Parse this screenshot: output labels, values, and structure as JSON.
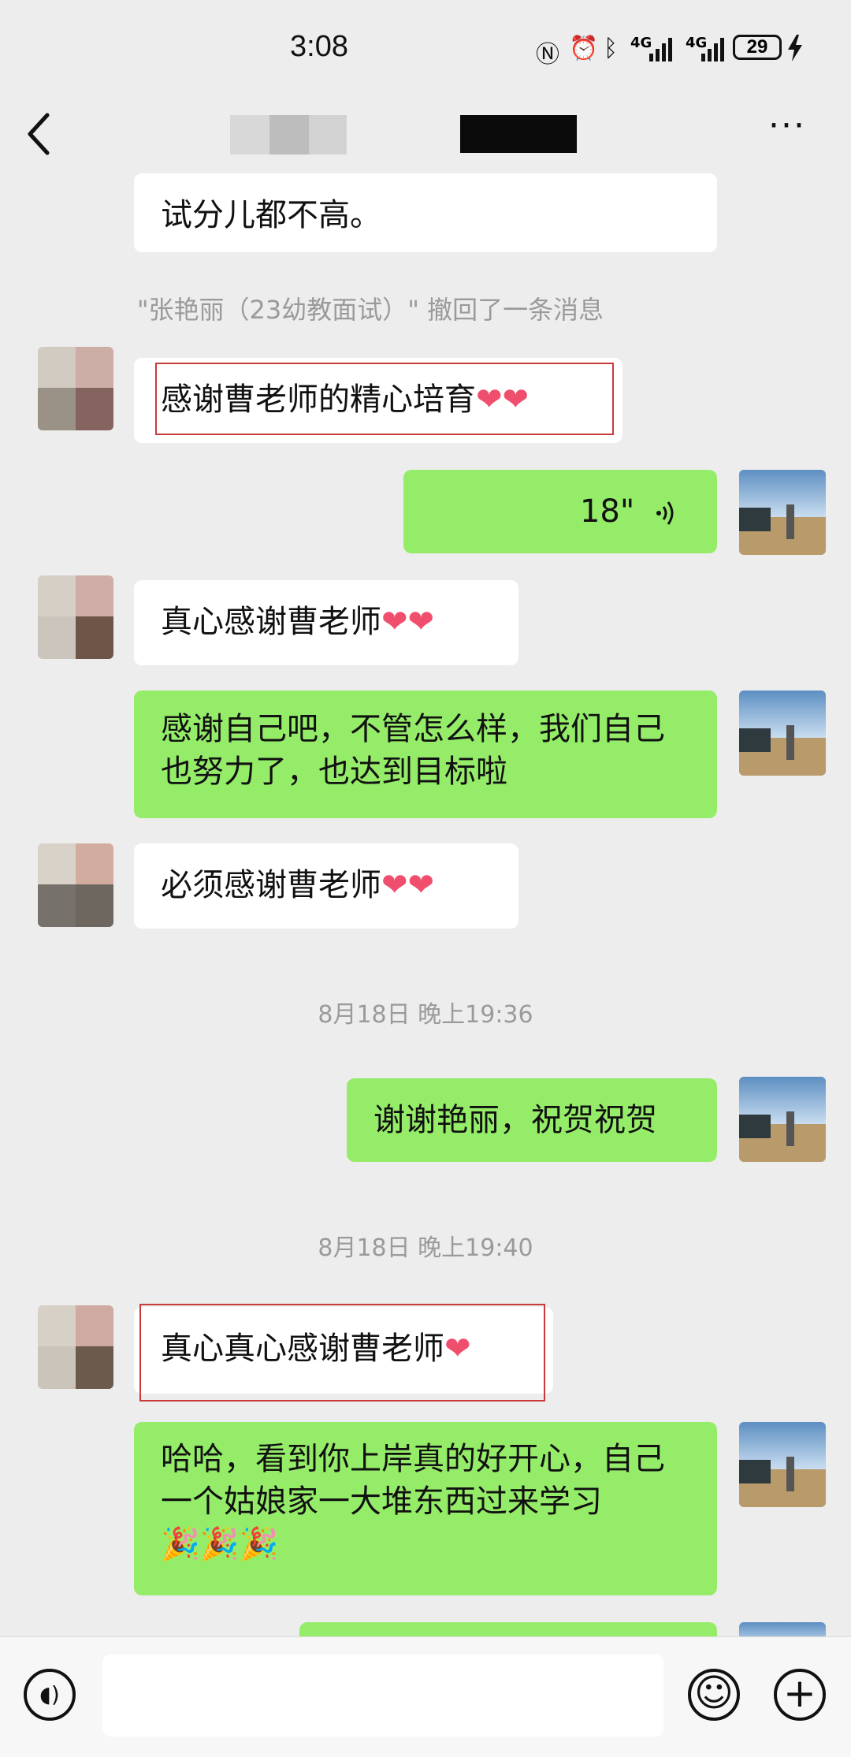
{
  "status_bar": {
    "time": "3:08",
    "signal_1": "4G",
    "signal_2": "4G",
    "battery": "29",
    "icons": [
      "nfc-icon",
      "alarm-icon",
      "bluetooth-icon",
      "signal-icon",
      "signal-icon",
      "battery-icon",
      "charging-icon"
    ]
  },
  "nav_bar": {
    "back_icon": "chevron-left-icon",
    "more_icon": "more-icon",
    "more_label": "···"
  },
  "messages": {
    "m0": {
      "text": "试分儿都不高。"
    },
    "recall": {
      "text": "\"张艳丽（23幼教面试）\" 撤回了一条消息"
    },
    "m1": {
      "text": "感谢曹老师的精心培育"
    },
    "m2": {
      "duration": "18\"",
      "icon": "voice-wave-icon"
    },
    "m3": {
      "text": "真心感谢曹老师"
    },
    "m4": {
      "text": "感谢自己吧，不管怎么样，我们自己也努力了，也达到目标啦"
    },
    "m5": {
      "text": "必须感谢曹老师"
    },
    "ts1": {
      "text": "8月18日 晚上19:36"
    },
    "m6": {
      "text": "谢谢艳丽，祝贺祝贺"
    },
    "ts2": {
      "text": "8月18日 晚上19:40"
    },
    "m7": {
      "text": "真心真心感谢曹老师"
    },
    "m8": {
      "text": "哈哈，看到你上岸真的好开心，自己一个姑娘家一大堆东西过来学习"
    }
  },
  "emoji": {
    "heart": "❤",
    "party": "🎉"
  },
  "input_bar": {
    "voice_icon": "voice-input-icon",
    "emoji_icon": "emoji-icon",
    "plus_icon": "plus-icon",
    "voice_glyph": "◖)",
    "emoji_glyph": "☺",
    "plus_glyph": "+"
  },
  "colors": {
    "background": "#ededed",
    "sent_bubble": "#95ec69",
    "received_bubble": "#ffffff",
    "highlight_border": "#c83a3a",
    "heart": "#ef4f6d"
  }
}
